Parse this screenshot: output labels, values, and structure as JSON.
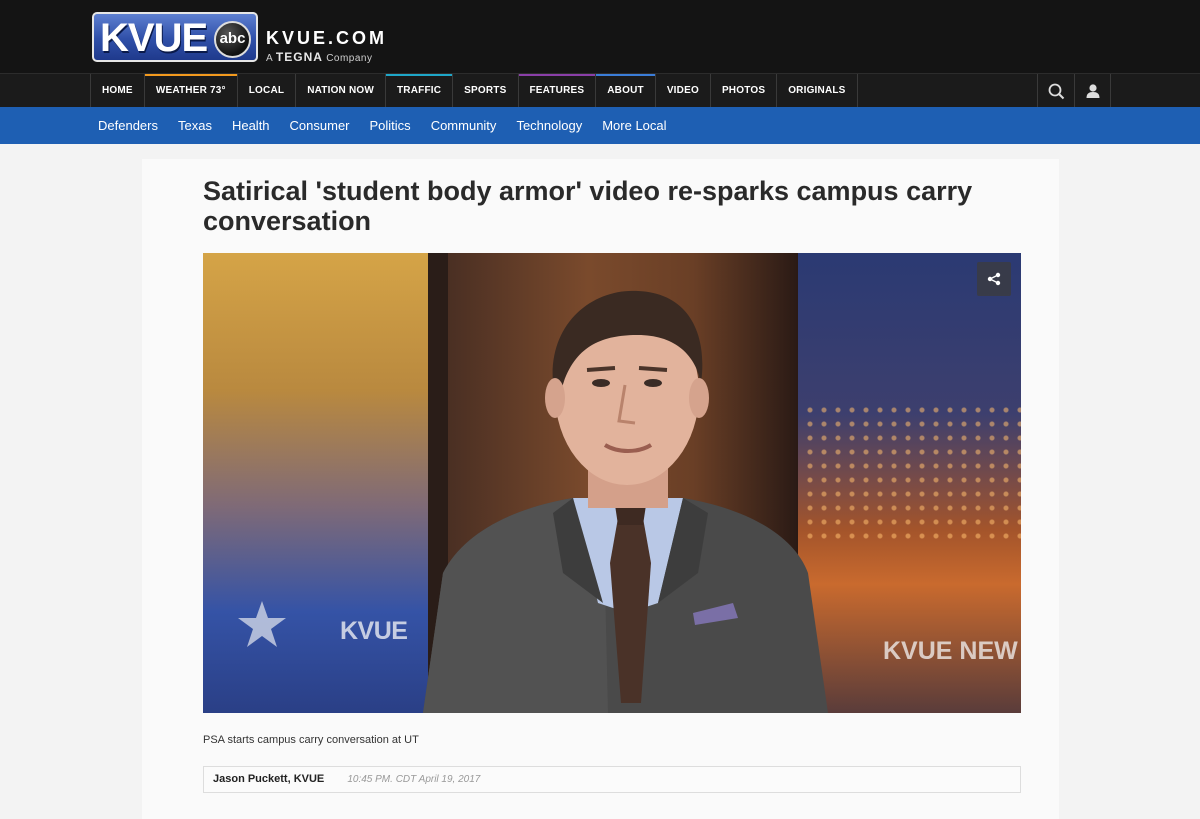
{
  "brand": {
    "logo_text": "KVUE",
    "network_badge": "abc",
    "site_name": "KVUE.COM",
    "tagline_prefix": "A",
    "tagline_brand": "TEGNA",
    "tagline_suffix": "Company"
  },
  "main_nav": {
    "items": [
      {
        "label": "HOME",
        "accent": ""
      },
      {
        "label": "WEATHER 73°",
        "accent": "#f39a1e"
      },
      {
        "label": "LOCAL",
        "accent": ""
      },
      {
        "label": "NATION NOW",
        "accent": ""
      },
      {
        "label": "TRAFFIC",
        "accent": "#1fa7c9"
      },
      {
        "label": "SPORTS",
        "accent": ""
      },
      {
        "label": "FEATURES",
        "accent": "#8a3fa8"
      },
      {
        "label": "ABOUT",
        "accent": "#3b7dd8"
      },
      {
        "label": "VIDEO",
        "accent": ""
      },
      {
        "label": "PHOTOS",
        "accent": ""
      },
      {
        "label": "ORIGINALS",
        "accent": ""
      }
    ],
    "icons": [
      "search-icon",
      "user-icon"
    ]
  },
  "sub_nav": {
    "items": [
      "Defenders",
      "Texas",
      "Health",
      "Consumer",
      "Politics",
      "Community",
      "Technology",
      "More Local"
    ]
  },
  "article": {
    "headline": "Satirical 'student body armor' video re-sparks campus carry conversation",
    "video": {
      "bug_left": "KVUE",
      "bug_right": "KVUE NEW",
      "share_icon": "share-icon"
    },
    "caption": "PSA starts campus carry conversation at UT",
    "author": "Jason Puckett, KVUE",
    "timestamp": "10:45 PM. CDT April 19, 2017"
  }
}
